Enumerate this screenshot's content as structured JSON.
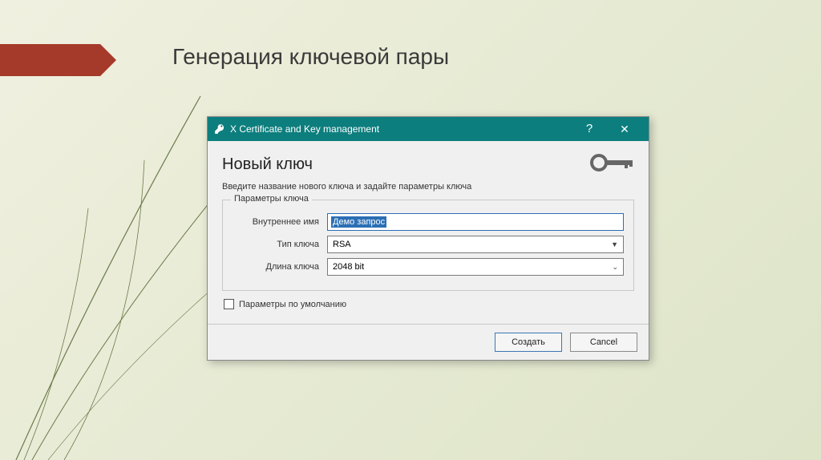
{
  "slide": {
    "title": "Генерация ключевой пары"
  },
  "dialog": {
    "window_title": "X Certificate and Key management",
    "heading": "Новый ключ",
    "instruction": "Введите название нового ключа и задайте параметры ключа",
    "fieldset_title": "Параметры ключа",
    "fields": {
      "name_label": "Внутреннее имя",
      "name_value": "Демо запрос",
      "type_label": "Тип ключа",
      "type_value": "RSA",
      "length_label": "Длина ключа",
      "length_value": "2048 bit"
    },
    "default_checkbox_label": "Параметры по умолчанию",
    "buttons": {
      "create": "Создать",
      "cancel": "Cancel"
    }
  }
}
